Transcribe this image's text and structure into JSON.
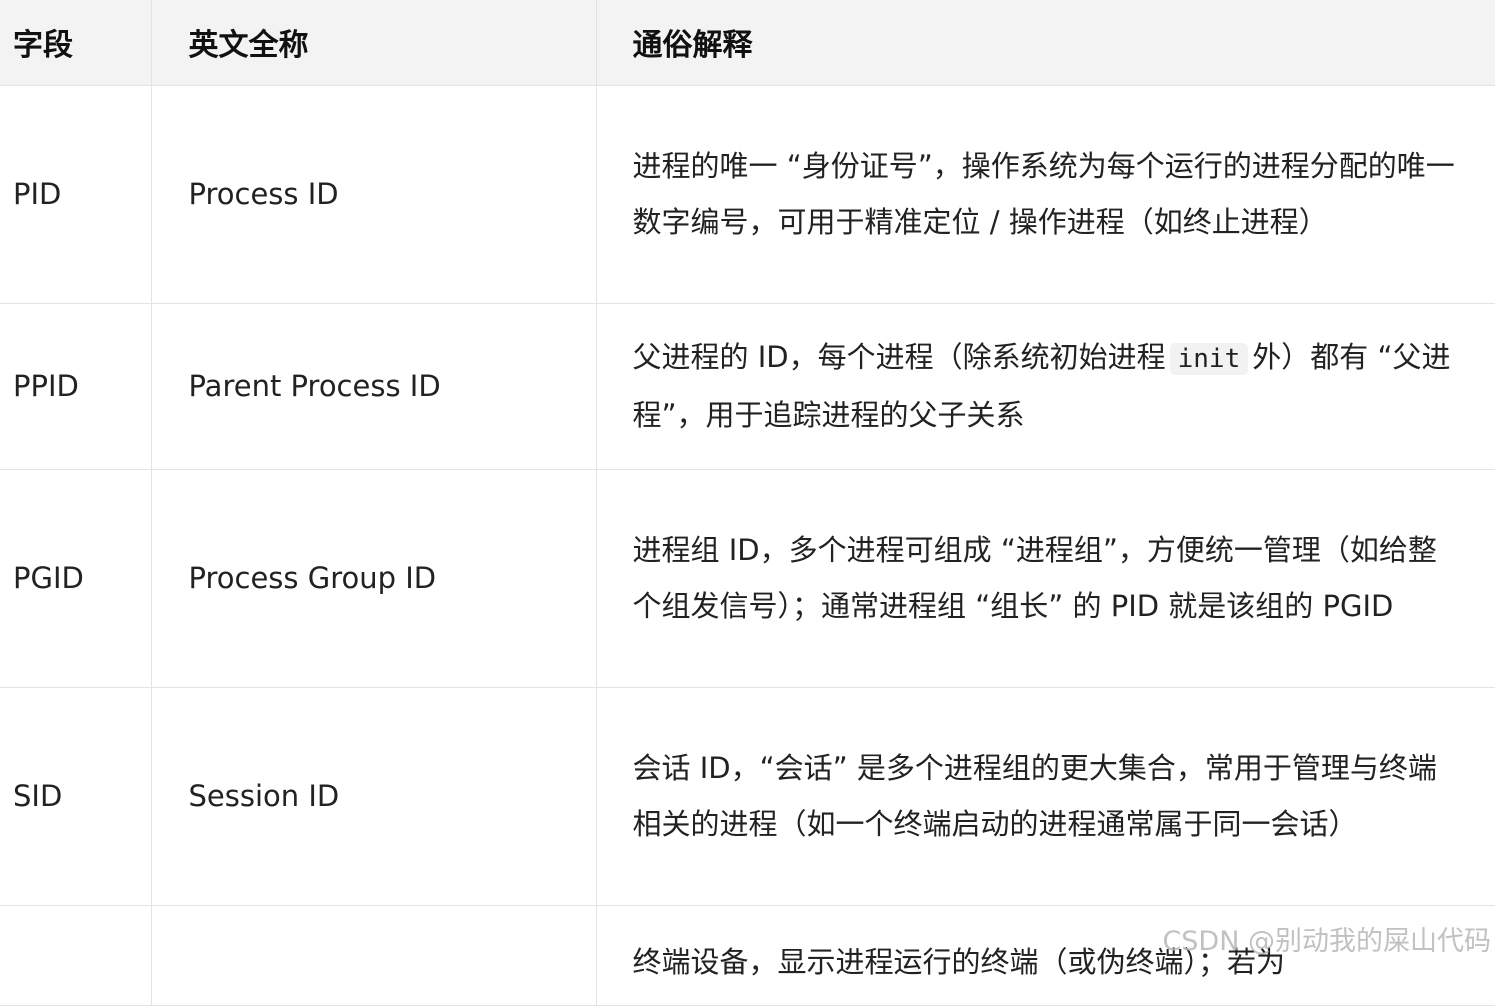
{
  "table": {
    "headers": [
      "字段",
      "英文全称",
      "通俗解释"
    ],
    "rows": [
      {
        "field": "PID",
        "full_name": "Process ID",
        "explain": "进程的唯一 “身份证号”，操作系统为每个运行的进程分配的唯一数字编号，可用于精准定位 / 操作进程（如终止进程）"
      },
      {
        "field": "PPID",
        "full_name": "Parent Process ID",
        "explain_before": "父进程的 ID，每个进程（除系统初始进程",
        "explain_code": "init",
        "explain_after": "外）都有 “父进程”，用于追踪进程的父子关系"
      },
      {
        "field": "PGID",
        "full_name": "Process Group ID",
        "explain": "进程组 ID，多个进程可组成 “进程组”，方便统一管理（如给整个组发信号）；通常进程组 “组长” 的 PID 就是该组的 PGID"
      },
      {
        "field": "SID",
        "full_name": "Session ID",
        "explain": "会话 ID，“会话” 是多个进程组的更大集合，常用于管理与终端相关的进程（如一个终端启动的进程通常属于同一会话）"
      },
      {
        "field": "",
        "full_name": "",
        "explain": "终端设备，显示进程运行的终端（或伪终端）；若为"
      }
    ]
  },
  "watermark": "CSDN @别动我的屎山代码"
}
